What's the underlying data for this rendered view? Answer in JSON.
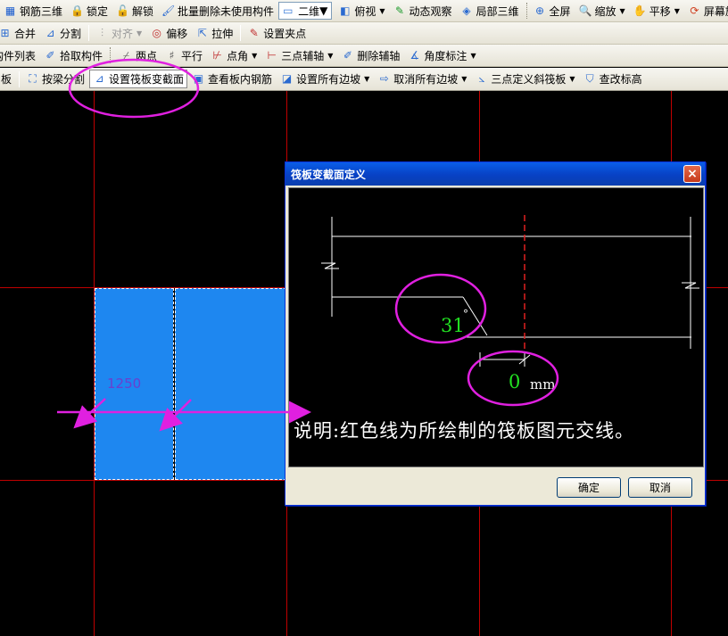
{
  "toolbar1": {
    "rebar3d": "钢筋三维",
    "lock": "锁定",
    "unlock": "解锁",
    "batch_delete": "批量删除未使用构件",
    "view2d": "二维",
    "top_view": "俯视",
    "dynamic_view": "动态观察",
    "local3d": "局部三维",
    "fullscreen": "全屏",
    "zoom": "缩放",
    "pan": "平移",
    "screen_rotate": "屏幕旋"
  },
  "toolbar2": {
    "merge": "合并",
    "split": "分割",
    "align": "对齐",
    "offset": "偏移",
    "stretch": "拉伸",
    "set_grip": "设置夹点"
  },
  "toolbar3": {
    "component_list": "构件列表",
    "pick_component": "拾取构件",
    "two_points": "两点",
    "parallel": "平行",
    "point_angle": "点角",
    "three_point_aux": "三点辅轴",
    "delete_aux": "删除辅轴",
    "angle_mark": "角度标注"
  },
  "toolbar4": {
    "slab_cut": "板",
    "split_by_beam": "按梁分割",
    "set_raft_section": "设置筏板变截面",
    "view_slab_rebar": "查看板内钢筋",
    "set_all_slopes": "设置所有边坡",
    "cancel_all_slopes": "取消所有边坡",
    "three_point_slope": "三点定义斜筏板",
    "modify_elevation": "查改标高"
  },
  "canvas": {
    "dimension": "1250"
  },
  "dialog": {
    "title": "筏板变截面定义",
    "close": "×",
    "angle_value": "31",
    "degree_symbol": "°",
    "offset_value": "0",
    "unit": "mm",
    "note": "说明:红色线为所绘制的筏板图元交线。",
    "ok": "确定",
    "cancel": "取消"
  },
  "colors": {
    "slab": "#1e87f0",
    "grid_line": "#c00000",
    "highlight": "#e020e0",
    "value_green": "#22e022",
    "title_bar": "#0a5ee8"
  }
}
